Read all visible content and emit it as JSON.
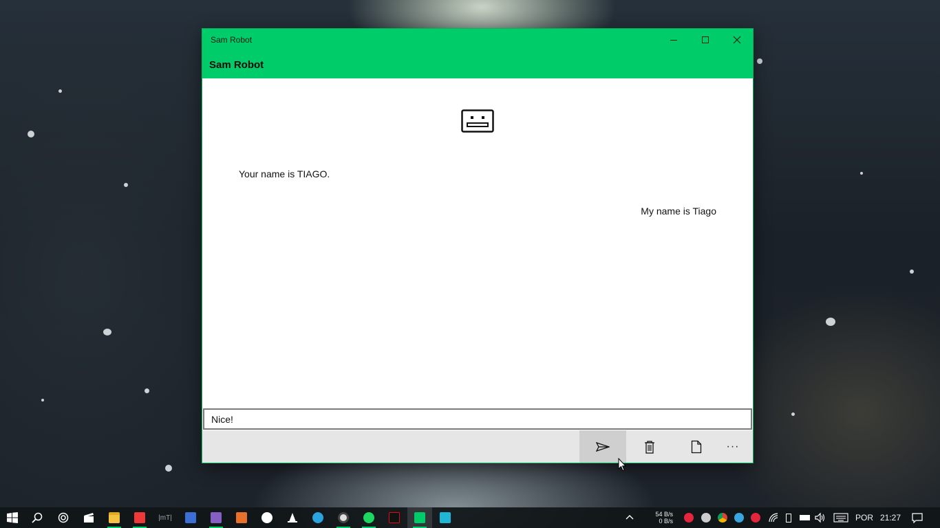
{
  "window": {
    "title": "Sam Robot",
    "app_title": "Sam Robot",
    "accent_color": "#00cc6a"
  },
  "chat": {
    "bot_icon": "robot-face-icon",
    "messages": [
      {
        "from": "bot",
        "text": "Your name is TIAGO."
      },
      {
        "from": "user",
        "text": "My name is Tiago"
      }
    ]
  },
  "input": {
    "value": "Nice!"
  },
  "commandbar": {
    "send_icon": "send-icon",
    "delete_icon": "trash-icon",
    "file_icon": "document-icon",
    "more_label": "···"
  },
  "taskbar": {
    "apps": [
      "windows-start",
      "search",
      "cortana",
      "video-editor",
      "file-explorer",
      "vivaldi",
      "mt-app",
      "app-blue",
      "visual-studio",
      "media-player",
      "xbox",
      "vlc",
      "telegram",
      "steamdeck-like",
      "spotify",
      "netflix",
      "sam-robot",
      "store"
    ],
    "net_up": "54 B/s",
    "net_down": "0 B/s",
    "language": "POR",
    "time": "21:27"
  }
}
